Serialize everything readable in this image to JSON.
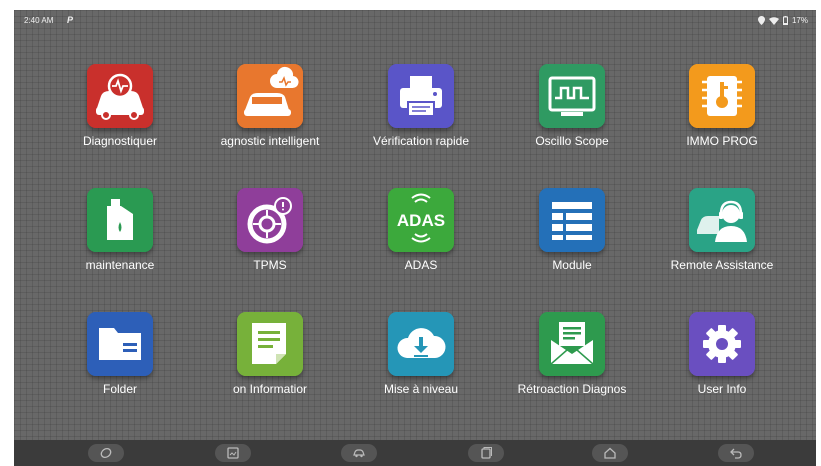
{
  "status_bar": {
    "time": "2:40 AM",
    "app_badge": "P",
    "battery": "17%"
  },
  "apps": [
    {
      "label": "Diagnostiquer",
      "icon": "car-diagnostic-icon",
      "color": "#c9302c"
    },
    {
      "label": "agnostic intelligent",
      "icon": "smart-diagnostic-car-icon",
      "color": "#e8772e"
    },
    {
      "label": "Vérification rapide",
      "icon": "printer-icon",
      "color": "#5a55c8"
    },
    {
      "label": "Oscillo Scope",
      "icon": "oscilloscope-icon",
      "color": "#2f9a62"
    },
    {
      "label": "IMMO PROG",
      "icon": "immo-chip-key-icon",
      "color": "#f39a1c"
    },
    {
      "label": "maintenance",
      "icon": "oil-can-icon",
      "color": "#2a9a52"
    },
    {
      "label": "TPMS",
      "icon": "tire-pressure-icon",
      "color": "#8f3e9a"
    },
    {
      "label": "ADAS",
      "icon": "adas-icon",
      "color": "#3ca93c"
    },
    {
      "label": "Module",
      "icon": "module-list-icon",
      "color": "#2470b8"
    },
    {
      "label": "Remote Assistance",
      "icon": "remote-support-icon",
      "color": "#2aa386"
    },
    {
      "label": "Folder",
      "icon": "folder-icon",
      "color": "#2d5fb8"
    },
    {
      "label": "on      Informatior",
      "icon": "information-document-icon",
      "color": "#77b13a"
    },
    {
      "label": "Mise à niveau",
      "icon": "cloud-download-icon",
      "color": "#2596b7"
    },
    {
      "label": "Rétroaction Diagnos",
      "icon": "feedback-envelope-icon",
      "color": "#2e9a4e"
    },
    {
      "label": "User Info",
      "icon": "settings-gear-icon",
      "color": "#6a4fc0"
    }
  ],
  "adas_text": "ADAS",
  "nav": [
    {
      "icon": "vci-link-icon"
    },
    {
      "icon": "screenshot-icon"
    },
    {
      "icon": "vehicle-icon"
    },
    {
      "icon": "recent-apps-icon"
    },
    {
      "icon": "home-icon"
    },
    {
      "icon": "back-icon"
    }
  ]
}
